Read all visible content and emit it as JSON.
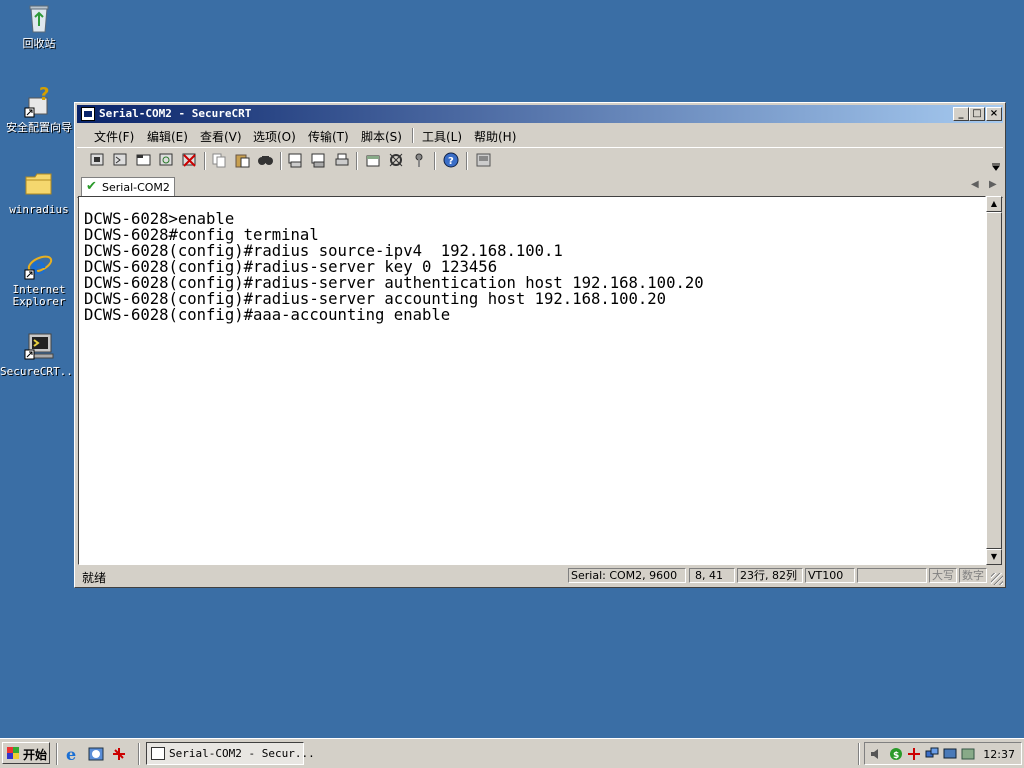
{
  "desktop": {
    "icons": [
      {
        "label": "回收站",
        "icon": "recycle-bin-icon"
      },
      {
        "label": "安全配置向导",
        "icon": "security-wizard-icon"
      },
      {
        "label": "winradius",
        "icon": "folder-icon"
      },
      {
        "label": "Internet Explorer",
        "label_line1": "Internet",
        "label_line2": "Explorer",
        "icon": "ie-icon"
      },
      {
        "label": "SecureCRT...",
        "icon": "securecrt-icon"
      }
    ]
  },
  "window": {
    "title": "Serial-COM2 - SecureCRT",
    "controls": {
      "minimize": "_",
      "maximize": "□",
      "close": "×"
    },
    "menu": [
      "文件(F)",
      "编辑(E)",
      "查看(V)",
      "选项(O)",
      "传输(T)",
      "脚本(S)",
      "工具(L)",
      "帮助(H)"
    ],
    "tab_label": "Serial-COM2",
    "terminal_lines": [
      "DCWS-6028>enable",
      "DCWS-6028#config terminal",
      "DCWS-6028(config)#radius source-ipv4  192.168.100.1",
      "DCWS-6028(config)#radius-server key 0 123456",
      "DCWS-6028(config)#radius-server authentication host 192.168.100.20",
      "DCWS-6028(config)#radius-server accounting host 192.168.100.20",
      "DCWS-6028(config)#aaa-accounting enable"
    ],
    "status": {
      "main": "就绪",
      "connection": "Serial: COM2, 9600",
      "cursor": "8, 41",
      "size": "23行, 82列",
      "emulation": "VT100",
      "blank": "",
      "caps": "大写",
      "num": "数字"
    }
  },
  "taskbar": {
    "start_label": "开始",
    "task_label": "Serial-COM2 - Secur...",
    "clock": "12:37"
  },
  "colors": {
    "desktop": "#3a6ea5",
    "titlebar_start": "#0a246a",
    "titlebar_end": "#a6caf0",
    "chrome": "#d4d0c8"
  }
}
